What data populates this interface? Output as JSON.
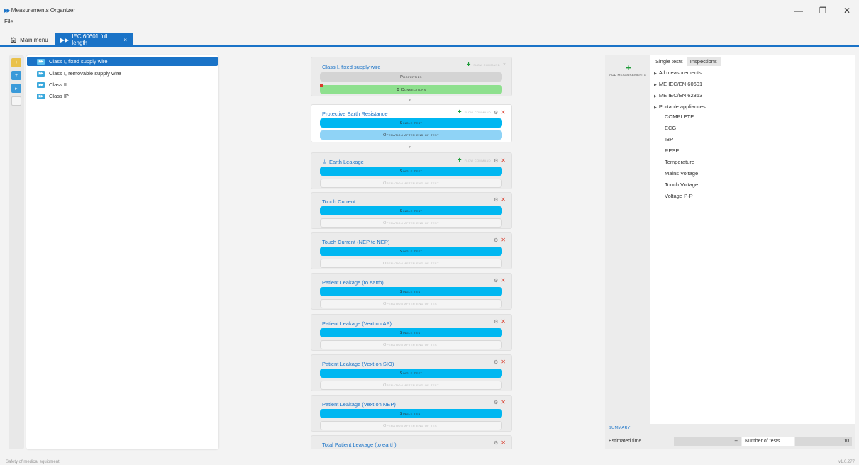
{
  "app": {
    "title": "Measurements Organizer"
  },
  "window": {
    "minimize": "—",
    "restore": "❐",
    "close": "✕"
  },
  "menu": {
    "file": "File"
  },
  "tabs": {
    "main": "Main menu",
    "active": "IEC 60601 full length",
    "close": "×"
  },
  "programs": [
    {
      "label": "Class I, fixed supply wire",
      "selected": true
    },
    {
      "label": "Class I, removable supply wire",
      "selected": false
    },
    {
      "label": "Class II",
      "selected": false
    },
    {
      "label": "Class IP",
      "selected": false
    }
  ],
  "sequence": {
    "header": {
      "title": "Class I, fixed supply wire",
      "flow_command": "FLOW COMMAND",
      "properties": "Properties",
      "connections": "⚙ Connections"
    },
    "single_test_label": "Single test",
    "op_after_label": "Operation after end of test",
    "tests": [
      {
        "title": "Protective Earth Resistance",
        "flow": true
      },
      {
        "title": "Earth Leakage",
        "flow": true
      },
      {
        "title": "Touch Current",
        "flow": false
      },
      {
        "title": "Touch Current (NEP to NEP)",
        "flow": false
      },
      {
        "title": "Patient Leakage (to earth)",
        "flow": false
      },
      {
        "title": "Patient Leakage (Vext on AP)",
        "flow": false
      },
      {
        "title": "Patient Leakage (Vext on SIO)",
        "flow": false
      },
      {
        "title": "Patient Leakage (Vext on NEP)",
        "flow": false
      },
      {
        "title": "Total Patient Leakage (to earth)",
        "flow": false
      }
    ]
  },
  "add_measurements": {
    "label": "ADD MEASUREMENTS",
    "plus": "+"
  },
  "right_panel": {
    "tabs": [
      "Single tests",
      "Inspections"
    ],
    "groups": [
      "All measurements",
      "ME IEC/EN 60601",
      "ME IEC/EN 62353",
      "Portable appliances"
    ],
    "items": [
      "COMPLETE",
      "ECG",
      "IBP",
      "RESP",
      "Temperature",
      "Mains Voltage",
      "Touch Voltage",
      "Voltage P-P"
    ]
  },
  "summary": {
    "label": "SUMMARY",
    "estimated_time_label": "Estimated time",
    "estimated_time_value": "--",
    "num_tests_label": "Number of tests",
    "num_tests_value": "10"
  },
  "status": {
    "left": "Safety of medical equipment",
    "right": "v1.0.277"
  },
  "colors": {
    "accent": "#1a73c7",
    "single_test": "#00b7f1",
    "connections": "#8ee08e",
    "flow_plus": "#1e9b39",
    "remove": "#d93a2a"
  }
}
